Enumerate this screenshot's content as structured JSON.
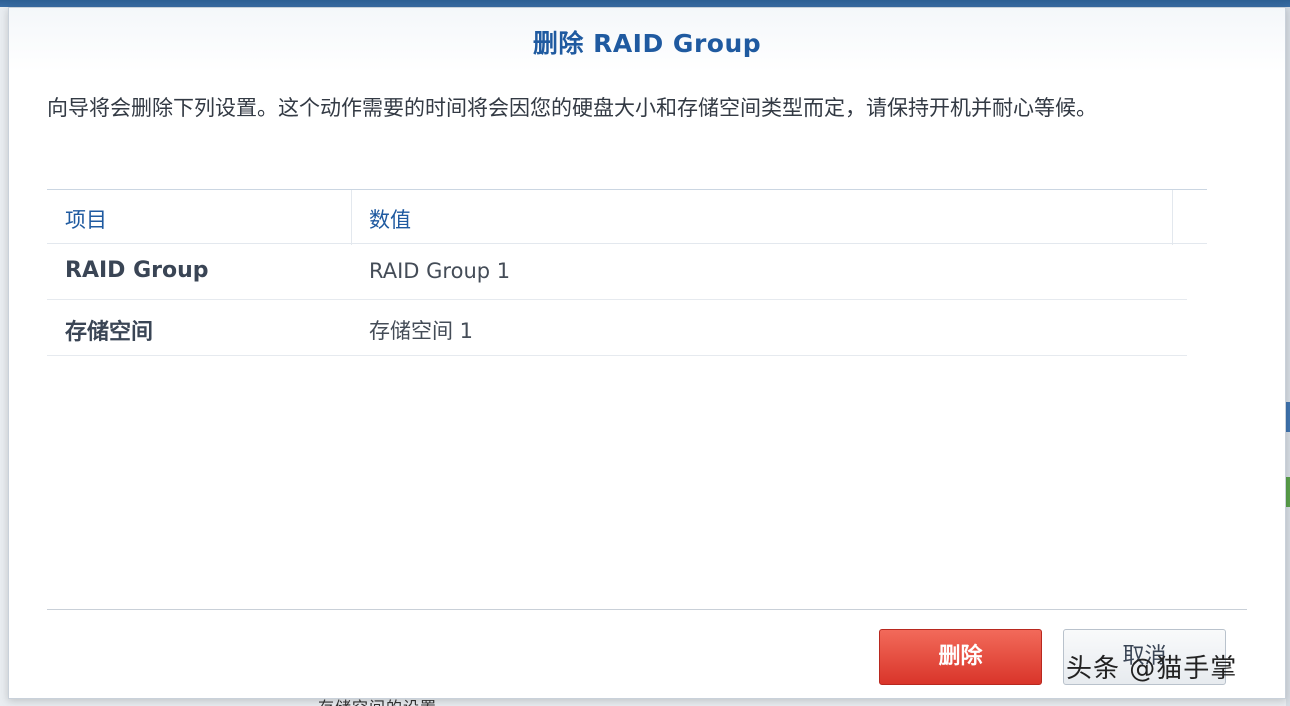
{
  "dialog": {
    "title": "删除 RAID Group",
    "description": "向导将会删除下列设置。这个动作需要的时间将会因您的硬盘大小和存储空间类型而定，请保持开机并耐心等候。"
  },
  "grid": {
    "headers": [
      "项目",
      "数值"
    ],
    "rows": [
      {
        "key": "RAID Group",
        "value": "RAID Group 1"
      },
      {
        "key": "存储空间",
        "value": "存储空间 1"
      }
    ]
  },
  "buttons": {
    "delete_label": "删除",
    "cancel_label": "取消"
  },
  "watermark": "头条 @猫手掌",
  "background": {
    "partial_text": "存储空间的设置"
  },
  "colors": {
    "title": "#1f5aa0",
    "delete_button": "#e2453a",
    "accent_strip": "#3a6ea6"
  }
}
